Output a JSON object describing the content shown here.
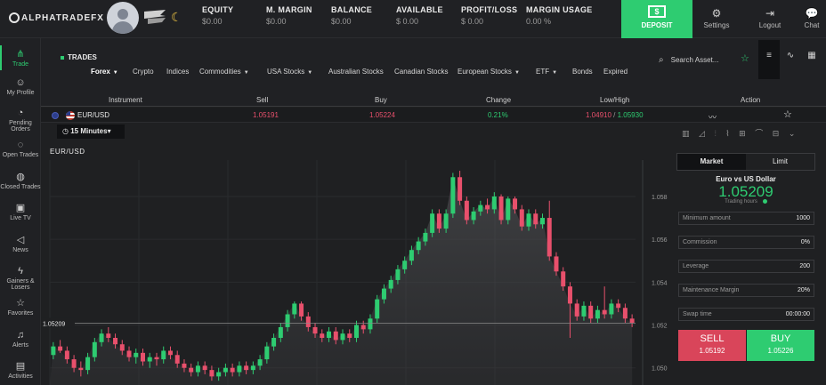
{
  "brand": {
    "logo_text": "ALPHATRADEFX"
  },
  "stats": [
    {
      "label": "EQUITY",
      "value": "$0.00"
    },
    {
      "label": "M. MARGIN",
      "value": "$0.00"
    },
    {
      "label": "BALANCE",
      "value": "$0.00"
    },
    {
      "label": "AVAILABLE",
      "value": "$ 0.00"
    },
    {
      "label": "PROFIT/LOSS",
      "value": "$ 0.00"
    },
    {
      "label": "MARGIN USAGE",
      "value": "0.00 %"
    }
  ],
  "topbar": {
    "deposit_label": "DEPOSIT",
    "deposit_icon": "$",
    "settings_label": "Settings",
    "logout_label": "Logout",
    "chat_label": "Chat"
  },
  "sidebar": {
    "items": [
      {
        "label": "Trade",
        "icon": "trade-icon"
      },
      {
        "label": "My Profile",
        "icon": "user-icon"
      },
      {
        "label": "Pending Orders",
        "icon": "pending-icon"
      },
      {
        "label": "Open Trades",
        "icon": "open-trades-icon"
      },
      {
        "label": "Closed Trades",
        "icon": "closed-trades-icon"
      },
      {
        "label": "Live TV",
        "icon": "tv-icon"
      },
      {
        "label": "News",
        "icon": "megaphone-icon"
      },
      {
        "label": "Gainers & Losers",
        "icon": "bolt-icon"
      },
      {
        "label": "Favorites",
        "icon": "star-icon"
      },
      {
        "label": "Alerts",
        "icon": "bell-icon"
      },
      {
        "label": "Activities",
        "icon": "activities-icon"
      }
    ]
  },
  "trades": {
    "title": "TRADES",
    "categories": [
      {
        "label": "Forex",
        "dropdown": true
      },
      {
        "label": "Crypto",
        "dropdown": false
      },
      {
        "label": "Indices",
        "dropdown": false
      },
      {
        "label": "Commodities",
        "dropdown": true
      },
      {
        "label": "USA Stocks",
        "dropdown": true
      },
      {
        "label": "Australian Stocks",
        "dropdown": false
      },
      {
        "label": "Canadian Stocks",
        "dropdown": false
      },
      {
        "label": "European Stocks",
        "dropdown": true
      },
      {
        "label": "ETF",
        "dropdown": true
      },
      {
        "label": "Bonds",
        "dropdown": false
      },
      {
        "label": "Expired",
        "dropdown": false
      }
    ],
    "search_placeholder": "Search Asset..."
  },
  "table": {
    "headers": [
      "Instrument",
      "Sell",
      "Buy",
      "Change",
      "Low/High",
      "Action"
    ],
    "row": {
      "instrument": "EUR/USD",
      "sell": "1.05191",
      "buy": "1.05224",
      "change": "0.21%",
      "low": "1.04910",
      "high": "1.05930"
    }
  },
  "chart": {
    "timeframe": "15 Minutes",
    "pair_label": "EUR/USD",
    "current_price_label": "1.05209"
  },
  "chart_data": {
    "type": "candlestick",
    "title": "EUR/USD",
    "y_ticks": [
      "1.058",
      "1.056",
      "1.054",
      "1.052",
      "1.050"
    ],
    "ylim": [
      1.0492,
      1.0597
    ],
    "current_price": 1.05209,
    "candles": [
      [
        1.0506,
        1.051,
        1.0504,
        1.0512
      ],
      [
        1.051,
        1.0508,
        1.0507,
        1.0513
      ],
      [
        1.0508,
        1.0504,
        1.0502,
        1.051
      ],
      [
        1.0504,
        1.05,
        1.0498,
        1.0506
      ],
      [
        1.05,
        1.0499,
        1.0496,
        1.0503
      ],
      [
        1.0499,
        1.0505,
        1.0497,
        1.0507
      ],
      [
        1.0505,
        1.0512,
        1.0503,
        1.0514
      ],
      [
        1.0512,
        1.0516,
        1.051,
        1.0518
      ],
      [
        1.0516,
        1.0514,
        1.0512,
        1.0519
      ],
      [
        1.0514,
        1.0511,
        1.0509,
        1.0516
      ],
      [
        1.0511,
        1.0508,
        1.0506,
        1.0513
      ],
      [
        1.0508,
        1.0505,
        1.0503,
        1.051
      ],
      [
        1.0505,
        1.0507,
        1.0502,
        1.0509
      ],
      [
        1.0507,
        1.0503,
        1.0501,
        1.0509
      ],
      [
        1.0503,
        1.0505,
        1.05,
        1.0507
      ],
      [
        1.0505,
        1.0504,
        1.0501,
        1.0507
      ],
      [
        1.0504,
        1.0508,
        1.0502,
        1.051
      ],
      [
        1.0508,
        1.0506,
        1.0504,
        1.051
      ],
      [
        1.0506,
        1.0502,
        1.05,
        1.0508
      ],
      [
        1.0502,
        1.05,
        1.0498,
        1.0504
      ],
      [
        1.05,
        1.0498,
        1.0496,
        1.0502
      ],
      [
        1.0498,
        1.0501,
        1.0496,
        1.0503
      ],
      [
        1.0501,
        1.0499,
        1.0497,
        1.0503
      ],
      [
        1.0499,
        1.0496,
        1.0494,
        1.0501
      ],
      [
        1.0496,
        1.0498,
        1.0494,
        1.05
      ],
      [
        1.0498,
        1.05,
        1.0496,
        1.0502
      ],
      [
        1.05,
        1.0498,
        1.0496,
        1.0502
      ],
      [
        1.0498,
        1.0501,
        1.0496,
        1.0503
      ],
      [
        1.0501,
        1.0499,
        1.0497,
        1.0503
      ],
      [
        1.0499,
        1.0501,
        1.0497,
        1.0503
      ],
      [
        1.0501,
        1.0504,
        1.0499,
        1.0506
      ],
      [
        1.0504,
        1.051,
        1.0502,
        1.0512
      ],
      [
        1.051,
        1.0514,
        1.0508,
        1.0516
      ],
      [
        1.0514,
        1.0519,
        1.0512,
        1.0521
      ],
      [
        1.0519,
        1.0525,
        1.0517,
        1.0527
      ],
      [
        1.0525,
        1.053,
        1.0523,
        1.0531
      ],
      [
        1.053,
        1.0524,
        1.0522,
        1.0531
      ],
      [
        1.0524,
        1.0519,
        1.0517,
        1.0526
      ],
      [
        1.0519,
        1.0516,
        1.0514,
        1.0521
      ],
      [
        1.0516,
        1.0514,
        1.0512,
        1.0518
      ],
      [
        1.0514,
        1.0517,
        1.0512,
        1.0519
      ],
      [
        1.0517,
        1.0513,
        1.0511,
        1.0519
      ],
      [
        1.0513,
        1.0516,
        1.0511,
        1.0518
      ],
      [
        1.0516,
        1.0514,
        1.0512,
        1.0518
      ],
      [
        1.0514,
        1.052,
        1.0512,
        1.0522
      ],
      [
        1.052,
        1.0518,
        1.0516,
        1.0522
      ],
      [
        1.0518,
        1.0523,
        1.0516,
        1.0525
      ],
      [
        1.0523,
        1.0532,
        1.0521,
        1.0534
      ],
      [
        1.0532,
        1.0537,
        1.053,
        1.0539
      ],
      [
        1.0537,
        1.0541,
        1.0535,
        1.0543
      ],
      [
        1.0541,
        1.0546,
        1.0539,
        1.0548
      ],
      [
        1.0546,
        1.055,
        1.0544,
        1.0552
      ],
      [
        1.055,
        1.0555,
        1.0548,
        1.0557
      ],
      [
        1.0555,
        1.0559,
        1.0553,
        1.0561
      ],
      [
        1.0559,
        1.0563,
        1.0557,
        1.0565
      ],
      [
        1.0563,
        1.0572,
        1.0561,
        1.0574
      ],
      [
        1.0572,
        1.0565,
        1.0563,
        1.0574
      ],
      [
        1.0565,
        1.0572,
        1.0563,
        1.0574
      ],
      [
        1.0572,
        1.0589,
        1.057,
        1.0591
      ],
      [
        1.0589,
        1.0578,
        1.0576,
        1.0592
      ],
      [
        1.0578,
        1.0569,
        1.0567,
        1.058
      ],
      [
        1.0569,
        1.0573,
        1.0567,
        1.0575
      ],
      [
        1.0573,
        1.0576,
        1.0571,
        1.0578
      ],
      [
        1.0576,
        1.0574,
        1.0572,
        1.0579
      ],
      [
        1.0574,
        1.058,
        1.0572,
        1.0582
      ],
      [
        1.058,
        1.0569,
        1.0567,
        1.0581
      ],
      [
        1.0569,
        1.0579,
        1.0567,
        1.058
      ],
      [
        1.0579,
        1.0574,
        1.0572,
        1.058
      ],
      [
        1.0574,
        1.0566,
        1.0564,
        1.0576
      ],
      [
        1.0566,
        1.0572,
        1.0564,
        1.0574
      ],
      [
        1.0572,
        1.0567,
        1.0565,
        1.0574
      ],
      [
        1.0567,
        1.057,
        1.0565,
        1.0572
      ],
      [
        1.057,
        1.0552,
        1.055,
        1.0578
      ],
      [
        1.0552,
        1.0545,
        1.0543,
        1.0554
      ],
      [
        1.0545,
        1.0538,
        1.0536,
        1.0547
      ],
      [
        1.0538,
        1.053,
        1.0514,
        1.054
      ],
      [
        1.053,
        1.0524,
        1.0522,
        1.0532
      ],
      [
        1.0524,
        1.0529,
        1.0522,
        1.0531
      ],
      [
        1.0529,
        1.0523,
        1.0521,
        1.0531
      ],
      [
        1.0523,
        1.0527,
        1.0521,
        1.0529
      ],
      [
        1.0527,
        1.0525,
        1.0523,
        1.0538
      ],
      [
        1.0525,
        1.053,
        1.0523,
        1.0532
      ],
      [
        1.053,
        1.0528,
        1.0526,
        1.0532
      ],
      [
        1.0528,
        1.0523,
        1.0521,
        1.053
      ],
      [
        1.0523,
        1.05209,
        1.0519,
        1.0525
      ]
    ]
  }
}
